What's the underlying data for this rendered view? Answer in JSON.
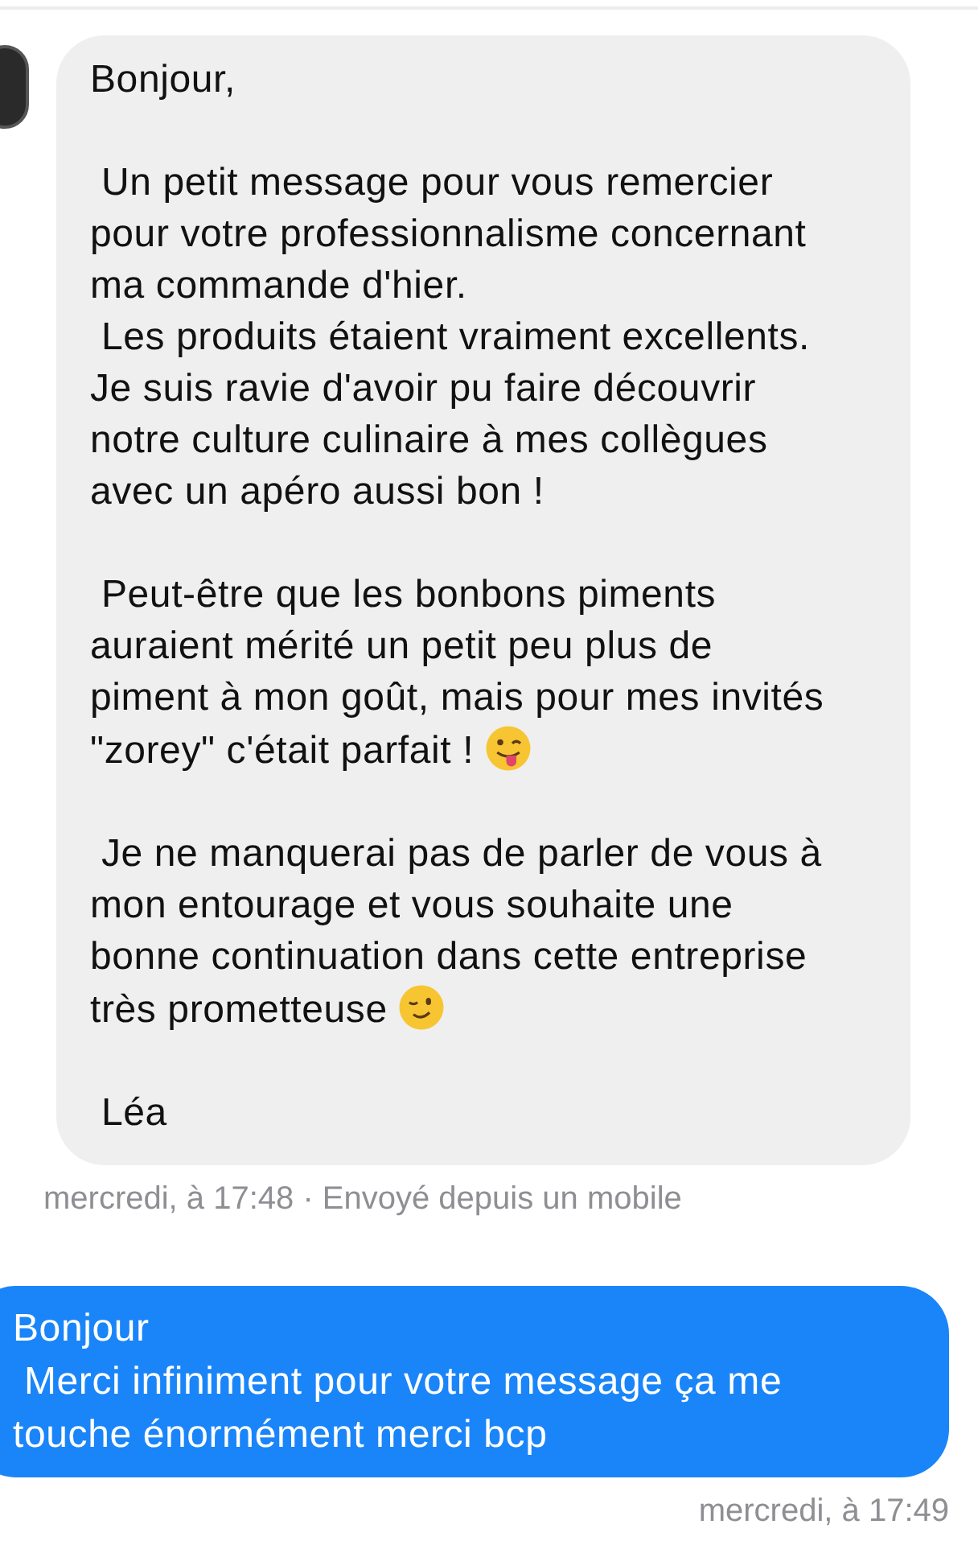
{
  "conversation": [
    {
      "kind": "received",
      "paragraphs": [
        {
          "kind": "plain",
          "text": "Bonjour,"
        },
        {
          "kind": "plain",
          "text": " Un petit message pour vous remercier\npour votre professionnalisme concernant\nma commande d'hier.\n Les produits étaient vraiment excellents.\nJe suis ravie d'avoir pu faire découvrir\nnotre culture culinaire à mes collègues\navec un apéro aussi bon !"
        },
        {
          "kind": "tongue_end",
          "text": " Peut-être que les bonbons piments\nauraient mérité un petit peu plus de\npiment à mon goût, mais pour mes invités\n\"zorey\" c'était parfait !"
        },
        {
          "kind": "wink_end",
          "text": " Je ne manquerai pas de parler de vous à\nmon entourage et vous souhaite une\nbonne continuation dans cette entreprise\ntrès prometteuse"
        },
        {
          "kind": "plain",
          "text": " Léa"
        }
      ],
      "meta": "mercredi, à 17:48 · Envoyé depuis un mobile"
    },
    {
      "kind": "sent",
      "paragraphs": [
        {
          "kind": "plain",
          "text": "Bonjour\n Merci infiniment pour votre message ça me\ntouche énormément merci bcp"
        }
      ],
      "meta": "mercredi, à 17:49"
    }
  ]
}
